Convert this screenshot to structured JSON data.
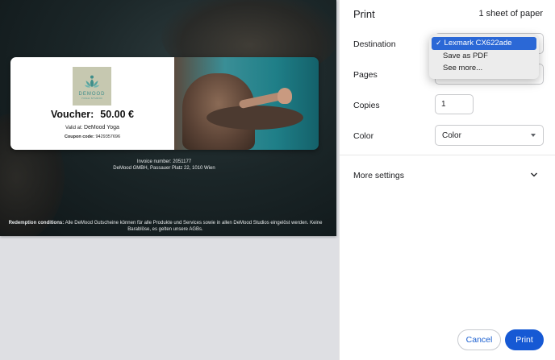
{
  "print_dialog": {
    "title": "Print",
    "sheet_count": "1 sheet of paper",
    "destination": {
      "label": "Destination",
      "options": [
        "Lexmark CX622ade",
        "Save as PDF",
        "See more..."
      ],
      "selected": "Lexmark CX622ade"
    },
    "pages": {
      "label": "Pages"
    },
    "copies": {
      "label": "Copies",
      "value": "1"
    },
    "color": {
      "label": "Color",
      "value": "Color"
    },
    "more_settings": "More settings",
    "cancel_label": "Cancel",
    "print_label": "Print"
  },
  "preview": {
    "logo": {
      "word": "DEMOOD",
      "sub": "YOGA STUDIO"
    },
    "voucher_label": "Voucher:",
    "voucher_amount": "50.00 €",
    "valid_label": "Valid at:",
    "valid_value": "DeMood Yoga",
    "coupon_label": "Coupon code:",
    "coupon_value": "9429357696",
    "invoice_number": "Invoice number: 2051177",
    "company_address": "DeMood GMBH, Passauer Platz 22, 1010 Wien",
    "redemption_label": "Redemption conditions:",
    "redemption_text": "Alle DeMood Gutscheine können für alle Produkte und Services sowie in allen DeMood Studios eingelöst werden. Keine Barablöse, es gelten unsere AGBs."
  },
  "colors": {
    "accent": "#1659d4",
    "dropdown_selected": "#2b68d6"
  }
}
